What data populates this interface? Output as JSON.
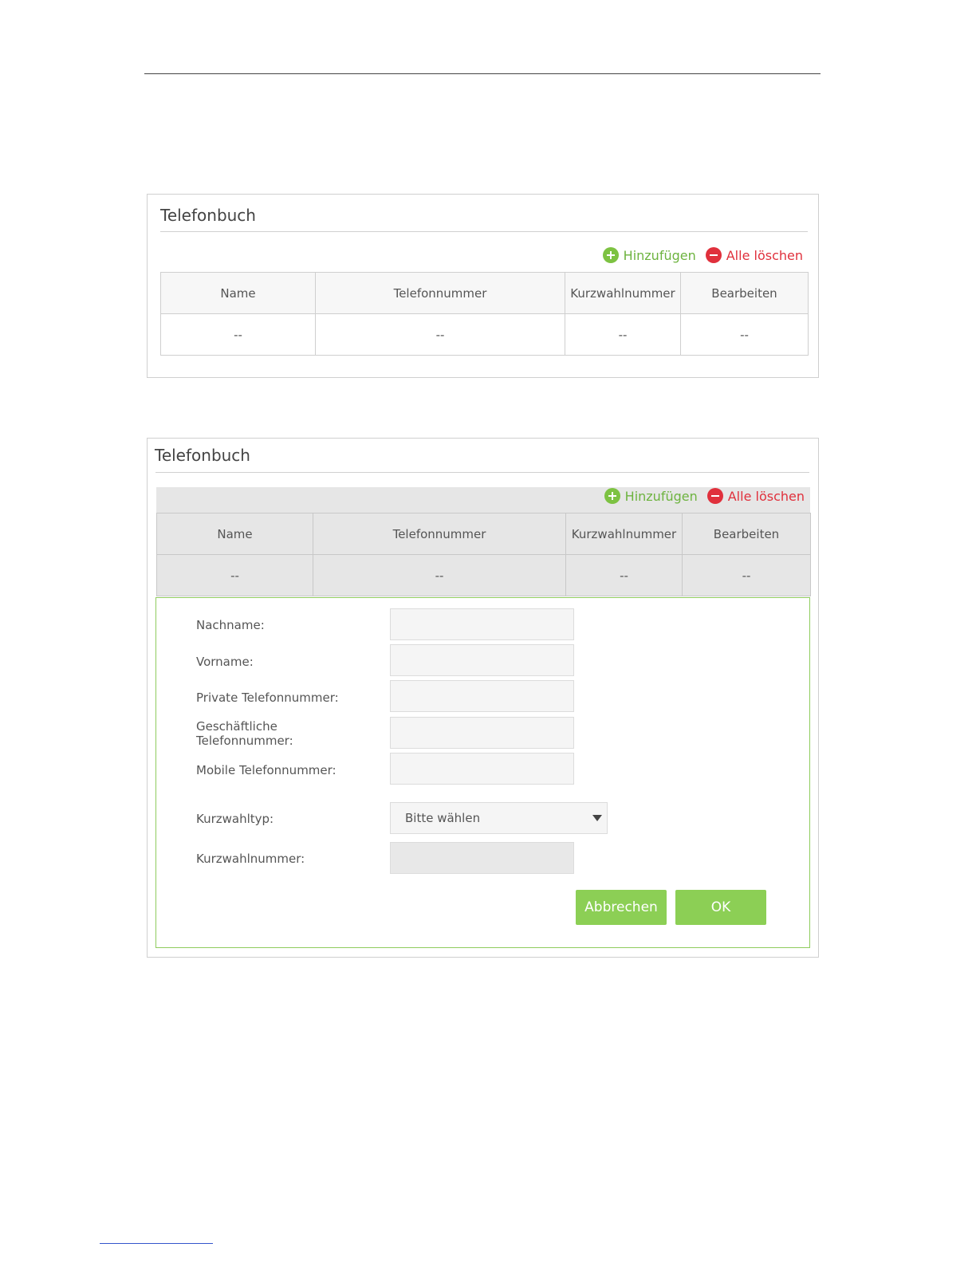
{
  "panel1": {
    "title": "Telefonbuch",
    "add_label": "Hinzufügen",
    "delete_all_label": "Alle löschen",
    "columns": [
      "Name",
      "Telefonnummer",
      "Kurzwahlnummer",
      "Bearbeiten"
    ],
    "rows": [
      [
        "--",
        "--",
        "--",
        "--"
      ]
    ]
  },
  "panel2": {
    "title": "Telefonbuch",
    "add_label": "Hinzufügen",
    "delete_all_label": "Alle löschen",
    "columns": [
      "Name",
      "Telefonnummer",
      "Kurzwahlnummer",
      "Bearbeiten"
    ],
    "rows": [
      [
        "--",
        "--",
        "--",
        "--"
      ]
    ],
    "form": {
      "last_name_label": "Nachname:",
      "first_name_label": "Vorname:",
      "private_phone_label": "Private Telefonnummer:",
      "business_phone_label_line1": "Geschäftliche",
      "business_phone_label_line2": "Telefonnummer:",
      "mobile_phone_label": "Mobile Telefonnummer:",
      "speed_dial_type_label": "Kurzwahltyp:",
      "speed_dial_type_value": "Bitte wählen",
      "speed_dial_number_label": "Kurzwahlnummer:",
      "cancel_label": "Abbrechen",
      "ok_label": "OK"
    }
  },
  "colors": {
    "accent_green": "#8ccf55",
    "add_green": "#7dc242",
    "delete_red": "#e0303c"
  }
}
